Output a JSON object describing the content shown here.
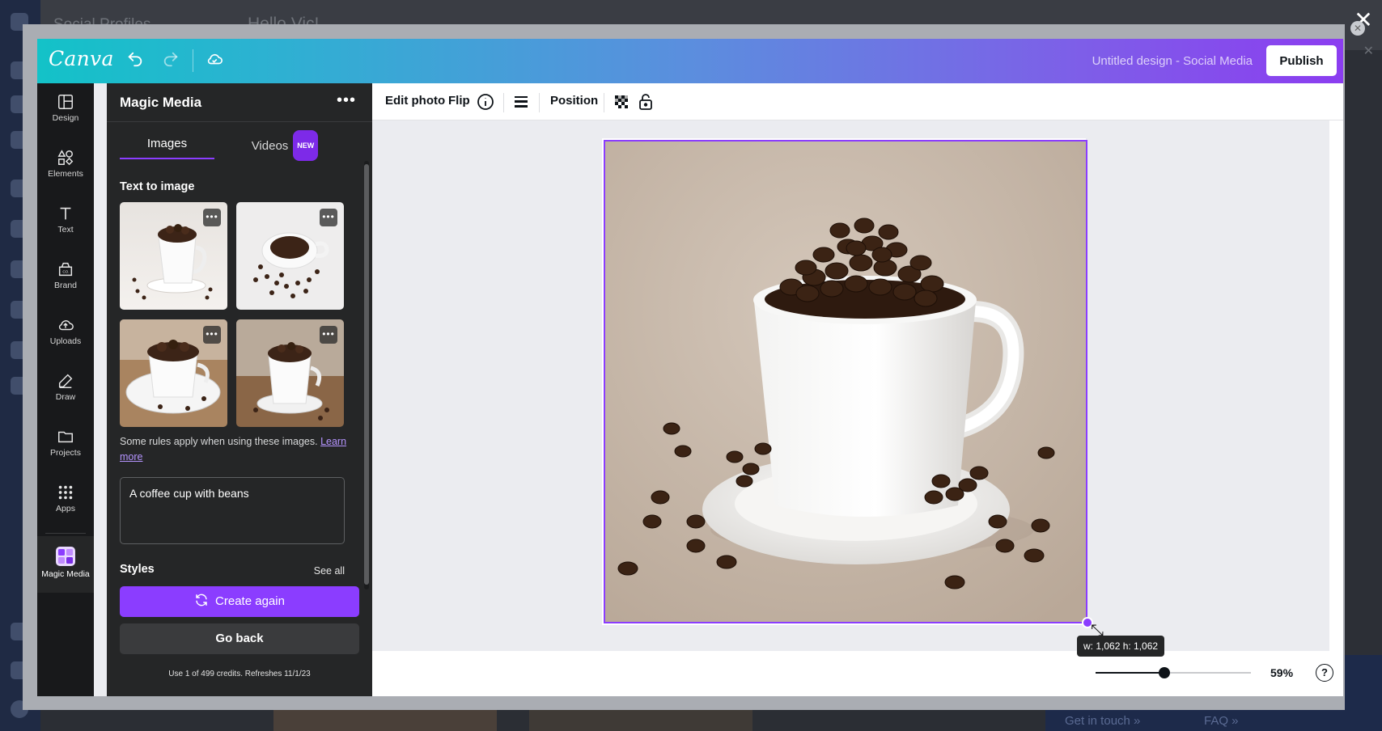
{
  "background": {
    "sidebar_title": "Social Profiles",
    "greeting": "Hello Vic!",
    "footer_links": [
      "Get in touch",
      "FAQ"
    ]
  },
  "header": {
    "logo": "Canva",
    "design_title": "Untitled design - Social Media",
    "publish_label": "Publish",
    "icons": [
      "undo-icon",
      "redo-icon",
      "cloud-save-icon"
    ]
  },
  "rail": {
    "items": [
      {
        "label": "Design",
        "icon": "design-icon"
      },
      {
        "label": "Elements",
        "icon": "elements-icon"
      },
      {
        "label": "Text",
        "icon": "text-icon"
      },
      {
        "label": "Brand",
        "icon": "brand-icon"
      },
      {
        "label": "Uploads",
        "icon": "uploads-icon"
      },
      {
        "label": "Draw",
        "icon": "draw-icon"
      },
      {
        "label": "Projects",
        "icon": "projects-icon"
      },
      {
        "label": "Apps",
        "icon": "apps-icon"
      },
      {
        "label": "Magic Media",
        "icon": "magic-media-icon",
        "active": true
      }
    ]
  },
  "panel": {
    "title": "Magic Media",
    "tabs": [
      {
        "label": "Images",
        "active": true
      },
      {
        "label": "Videos",
        "badge": "NEW"
      }
    ],
    "section_label": "Text to image",
    "rules_text": "Some rules apply when using these images.",
    "rules_link": "Learn more",
    "prompt_value": "A coffee cup with beans",
    "styles_label": "Styles",
    "see_all_label": "See all",
    "create_again_label": "Create again",
    "go_back_label": "Go back",
    "credits_text": "Use 1 of 499 credits. Refreshes 11/1/23"
  },
  "toolbar": {
    "edit_photo": "Edit photo",
    "flip": "Flip",
    "position": "Position"
  },
  "canvas": {
    "size_tooltip": "w: 1,062 h: 1,062",
    "zoom": "59%",
    "help": "?"
  },
  "colors": {
    "accent": "#8b3dff",
    "panel_bg": "#252627",
    "rail_bg": "#18191b",
    "canvas_bg": "#ebecf0"
  }
}
